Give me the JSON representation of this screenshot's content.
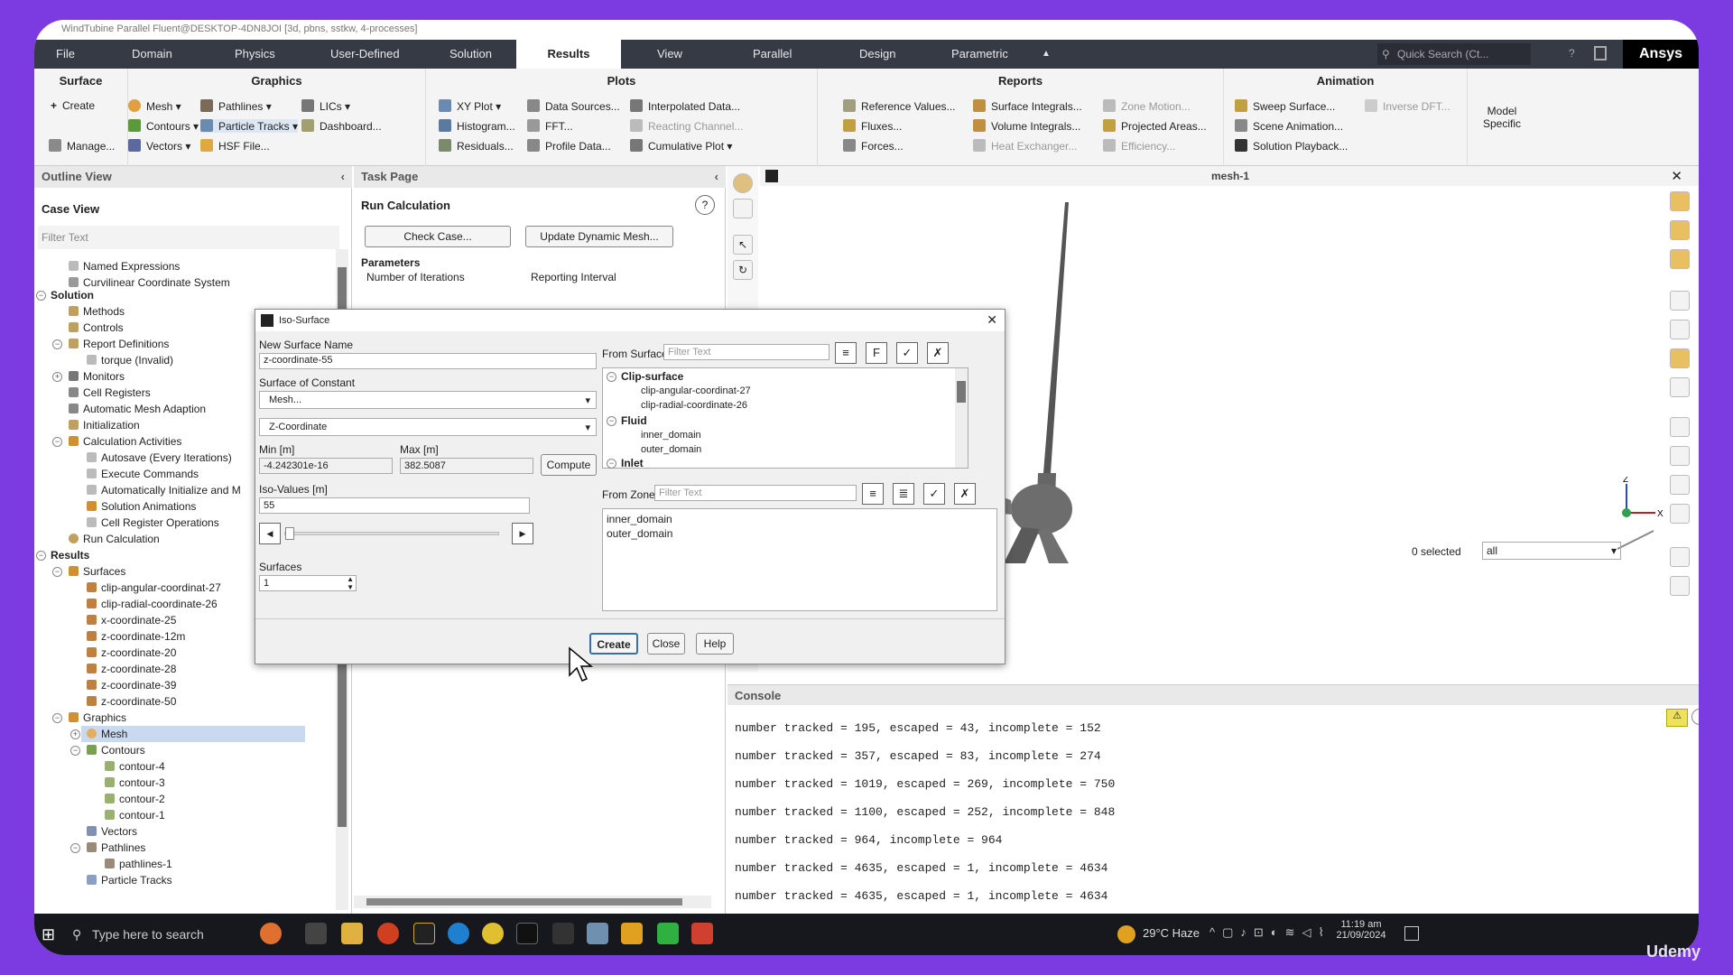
{
  "window_title": "WindTubine Parallel Fluent@DESKTOP-4DN8JOI [3d, pbns, sstkw, 4-processes]",
  "menu": {
    "tabs": [
      "File",
      "Domain",
      "Physics",
      "User-Defined",
      "Solution",
      "Results",
      "View",
      "Parallel",
      "Design",
      "Parametric"
    ],
    "active": "Results",
    "quick_search": "Quick Search (Ct...",
    "brand": "Ansys"
  },
  "ribbon": {
    "surface": {
      "title": "Surface",
      "create": "Create",
      "manage": "Manage..."
    },
    "graphics": {
      "title": "Graphics",
      "mesh": "Mesh",
      "contours": "Contours",
      "vectors": "Vectors",
      "pathlines": "Pathlines",
      "particle_tracks": "Particle Tracks",
      "hsf": "HSF File...",
      "lics": "LICs",
      "dashboard": "Dashboard..."
    },
    "plots": {
      "title": "Plots",
      "xy": "XY Plot",
      "histogram": "Histogram...",
      "residuals": "Residuals...",
      "data_sources": "Data Sources...",
      "fft": "FFT...",
      "profile": "Profile Data...",
      "interpolated": "Interpolated Data...",
      "reacting": "Reacting Channel...",
      "cumulative": "Cumulative Plot"
    },
    "reports": {
      "title": "Reports",
      "reference": "Reference Values...",
      "fluxes": "Fluxes...",
      "forces": "Forces...",
      "surface_int": "Surface Integrals...",
      "volume_int": "Volume Integrals...",
      "heat_ex": "Heat Exchanger...",
      "zone_motion": "Zone Motion...",
      "projected": "Projected Areas...",
      "efficiency": "Efficiency..."
    },
    "animation": {
      "title": "Animation",
      "sweep": "Sweep Surface...",
      "scene": "Scene Animation...",
      "playback": "Solution Playback...",
      "inverse": "Inverse DFT...",
      "model_specific": "Model Specific"
    }
  },
  "outline": {
    "title": "Outline View",
    "case_view": "Case View",
    "filter_placeholder": "Filter Text",
    "items": [
      "Named Expressions",
      "Curvilinear Coordinate System",
      "Solution",
      "Methods",
      "Controls",
      "Report Definitions",
      "torque (Invalid)",
      "Monitors",
      "Cell Registers",
      "Automatic Mesh Adaption",
      "Initialization",
      "Calculation Activities",
      "Autosave (Every Iterations)",
      "Execute Commands",
      "Automatically Initialize and M",
      "Solution Animations",
      "Cell Register Operations",
      "Run Calculation",
      "Results",
      "Surfaces",
      "clip-angular-coordinat-27",
      "clip-radial-coordinate-26",
      "x-coordinate-25",
      "z-coordinate-12m",
      "z-coordinate-20",
      "z-coordinate-28",
      "z-coordinate-39",
      "z-coordinate-50",
      "Graphics",
      "Mesh",
      "Contours",
      "contour-4",
      "contour-3",
      "contour-2",
      "contour-1",
      "Vectors",
      "Pathlines",
      "pathlines-1",
      "Particle Tracks"
    ]
  },
  "task": {
    "title": "Task Page",
    "section": "Run Calculation",
    "check_case": "Check Case...",
    "update_mesh": "Update Dynamic Mesh...",
    "parameters": "Parameters",
    "iterations_label": "Number of Iterations",
    "reporting_label": "Reporting Interval"
  },
  "viewport": {
    "title": "mesh-1",
    "selected": "0 selected",
    "select_value": "all"
  },
  "dialog": {
    "title": "Iso-Surface",
    "new_name_label": "New Surface Name",
    "new_name_value": "z-coordinate-55",
    "constant_label": "Surface of Constant",
    "constant_value": "Mesh...",
    "coordinate_value": "Z-Coordinate",
    "min_label": "Min [m]",
    "min_value": "-4.242301e-16",
    "max_label": "Max [m]",
    "max_value": "382.5087",
    "compute": "Compute",
    "iso_label": "Iso-Values [m]",
    "iso_value": "55",
    "surfaces_label": "Surfaces",
    "surfaces_value": "1",
    "from_surface_label": "From Surface",
    "filter_placeholder": "Filter Text",
    "surface_groups": [
      {
        "name": "Clip-surface",
        "items": [
          "clip-angular-coordinat-27",
          "clip-radial-coordinate-26"
        ]
      },
      {
        "name": "Fluid",
        "items": [
          "inner_domain",
          "outer_domain"
        ]
      },
      {
        "name": "Inlet",
        "items": []
      }
    ],
    "from_zones_label": "From Zones",
    "zones": [
      "inner_domain",
      "outer_domain"
    ],
    "create": "Create",
    "close": "Close",
    "help": "Help"
  },
  "console": {
    "title": "Console",
    "lines": [
      "number tracked = 195, escaped = 43, incomplete = 152",
      "number tracked = 357, escaped = 83, incomplete = 274",
      "number tracked = 1019, escaped = 269, incomplete = 750",
      "number tracked = 1100, escaped = 252, incomplete = 848",
      "number tracked = 964, incomplete = 964",
      "number tracked = 4635, escaped = 1, incomplete = 4634",
      "number tracked = 4635, escaped = 1, incomplete = 4634"
    ]
  },
  "taskbar": {
    "search": "Type here to search",
    "weather": "29°C  Haze",
    "time": "11:19 am",
    "date": "21/09/2024"
  },
  "watermark": "Udemy"
}
